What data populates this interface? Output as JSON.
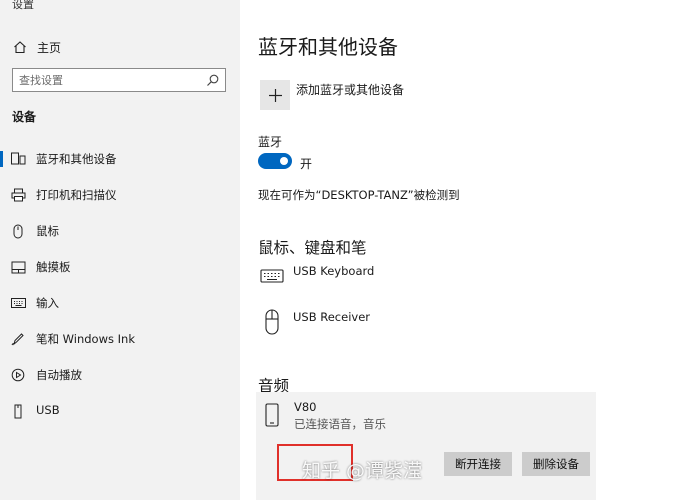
{
  "window": {
    "app_title": "设置"
  },
  "sidebar": {
    "home_label": "主页",
    "search_placeholder": "查找设置",
    "section_title": "设备",
    "items": [
      {
        "label": "蓝牙和其他设备",
        "icon": "bluetooth-devices-icon",
        "selected": true
      },
      {
        "label": "打印机和扫描仪",
        "icon": "printer-icon"
      },
      {
        "label": "鼠标",
        "icon": "mouse-icon"
      },
      {
        "label": "触摸板",
        "icon": "touchpad-icon"
      },
      {
        "label": "输入",
        "icon": "keyboard-icon"
      },
      {
        "label": "笔和 Windows Ink",
        "icon": "pen-icon"
      },
      {
        "label": "自动播放",
        "icon": "autoplay-icon"
      },
      {
        "label": "USB",
        "icon": "usb-icon"
      }
    ]
  },
  "main": {
    "title": "蓝牙和其他设备",
    "add_device_label": "添加蓝牙或其他设备",
    "bluetooth": {
      "label": "蓝牙",
      "toggle_state": "开",
      "on": true,
      "discoverable_text": "现在可作为“DESKTOP-TANZ”被检测到"
    },
    "input_section": {
      "title": "鼠标、键盘和笔",
      "devices": [
        {
          "name": "USB Keyboard",
          "icon": "keyboard-icon"
        },
        {
          "name": "USB Receiver",
          "icon": "mouse-icon"
        }
      ]
    },
    "audio_section": {
      "title": "音频",
      "devices": [
        {
          "name": "V80",
          "status": "已连接语音，音乐",
          "icon": "phone-icon"
        }
      ],
      "disconnect_label": "断开连接",
      "remove_label": "删除设备"
    }
  },
  "watermark": "知乎 @谭紫滢",
  "colors": {
    "accent": "#0067c0",
    "sidebar_bg": "#f2f2f2",
    "highlight": "#e0302a"
  }
}
